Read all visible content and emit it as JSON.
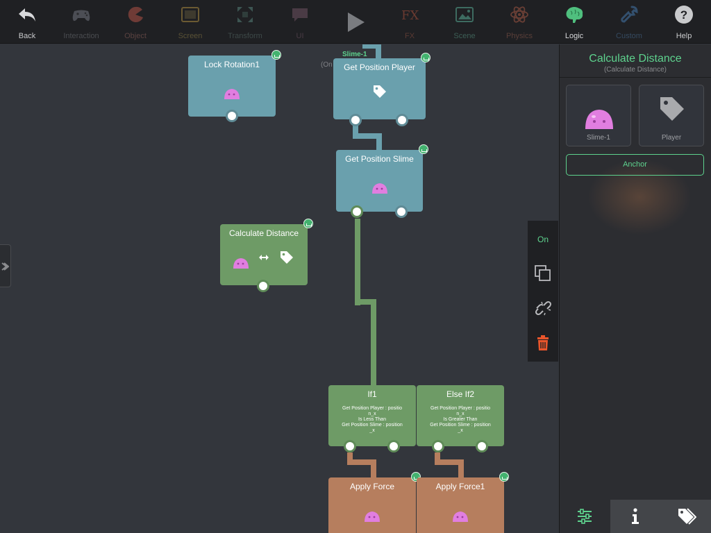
{
  "toolbar": {
    "back": "Back",
    "interaction": "Interaction",
    "object": "Object",
    "screen": "Screen",
    "transform": "Transform",
    "ui": "UI",
    "fx": "FX",
    "scene": "Scene",
    "physics": "Physics",
    "logic": "Logic",
    "custom": "Custom",
    "help": "Help"
  },
  "canvas": {
    "partial_label": "Slime-1",
    "partial_label2": "(On",
    "nodes": {
      "lock_rotation": "Lock Rotation1",
      "get_position_player": "Get Position Player",
      "get_position_slime": "Get Position Slime",
      "calculate_distance": "Calculate Distance",
      "if1": {
        "title": "If1",
        "line1": "Get Position Player : positio",
        "line2": "n_x",
        "line3": "Is Less Than",
        "line4": "Get Position Slime : position",
        "line5": "_x"
      },
      "else_if2": {
        "title": "Else If2",
        "line1": "Get Position Player : positio",
        "line2": "n_x",
        "line3": "Is Greater Than",
        "line4": "Get Position Slime : position",
        "line5": "_x"
      },
      "apply_force": "Apply Force",
      "apply_force1": "Apply Force1"
    }
  },
  "context_menu": {
    "on_label": "On",
    "icons": [
      "duplicate-icon",
      "unlink-icon",
      "trash-icon"
    ]
  },
  "panel": {
    "title": "Calculate Distance",
    "subtitle": "(Calculate Distance)",
    "cards": [
      {
        "label": "Slime-1",
        "icon": "slime-icon"
      },
      {
        "label": "Player",
        "icon": "tag-icon"
      }
    ],
    "anchor_button": "Anchor",
    "tabs": [
      "settings-sliders-icon",
      "info-icon",
      "tags-icon"
    ]
  },
  "colors": {
    "accent": "#5ed38e",
    "node_blue": "#6aa0ad",
    "node_green": "#6e9b66",
    "node_orange": "#b67e5e",
    "delete_red": "#e8552b"
  }
}
